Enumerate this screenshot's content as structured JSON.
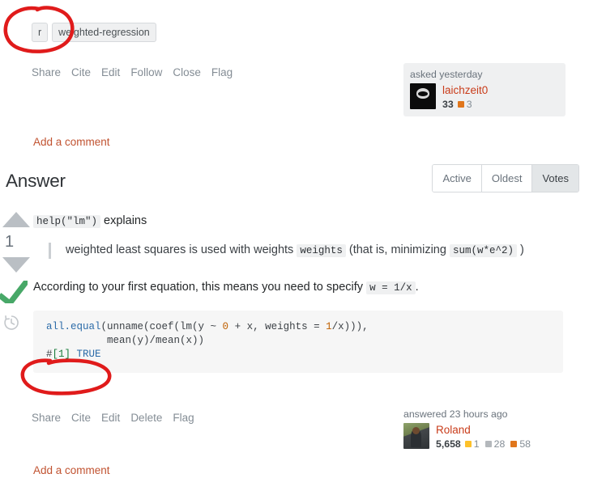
{
  "question": {
    "tags": [
      "r",
      "weighted-regression"
    ],
    "actions": [
      "Share",
      "Cite",
      "Edit",
      "Follow",
      "Close",
      "Flag"
    ],
    "add_comment": "Add a comment",
    "user_card": {
      "action_time": "asked yesterday",
      "username": "laichzeit0",
      "reputation": "33",
      "badges": [
        {
          "type": "bronze",
          "count": "3"
        }
      ]
    }
  },
  "answers_section": {
    "title": "Answer",
    "sort_tabs": [
      {
        "label": "Active",
        "active": false
      },
      {
        "label": "Oldest",
        "active": false
      },
      {
        "label": "Votes",
        "active": true
      }
    ]
  },
  "answer": {
    "vote_count": "1",
    "accepted": true,
    "para1_before_code": "",
    "para1_code": "help(\"lm\")",
    "para1_after_code": " explains",
    "blockquote": {
      "text_1": "weighted least squares is used with weights ",
      "code_1": "weights",
      "text_2": " (that is, minimizing ",
      "code_2": "sum(w*e^2)",
      "text_3": " )"
    },
    "para2": {
      "text_1": "According to your first equation, this means you need to specify ",
      "code_1": "w = 1/x",
      "text_2": "."
    },
    "code_block": {
      "line1_part1": "all.equal",
      "line1_part2": "(unname(coef(lm(y ~ ",
      "line1_num1": "0",
      "line1_part3": " + x, weights = ",
      "line1_num2": "1",
      "line1_part4": "/x))),",
      "line2": "          mean(y)/mean(x))",
      "line3_hash": "#",
      "line3_index": "[1]",
      "line3_value": " TRUE"
    },
    "actions": [
      "Share",
      "Cite",
      "Edit",
      "Delete",
      "Flag"
    ],
    "add_comment": "Add a comment",
    "user_card": {
      "action_time": "answered 23 hours ago",
      "username": "Roland",
      "reputation": "5,658",
      "badges": [
        {
          "type": "gold",
          "count": "1"
        },
        {
          "type": "silver",
          "count": "28"
        },
        {
          "type": "bronze",
          "count": "58"
        }
      ]
    }
  },
  "annotations": {
    "color": "#e01b1b",
    "circles": [
      "tags-circle",
      "true-output-circle"
    ]
  }
}
